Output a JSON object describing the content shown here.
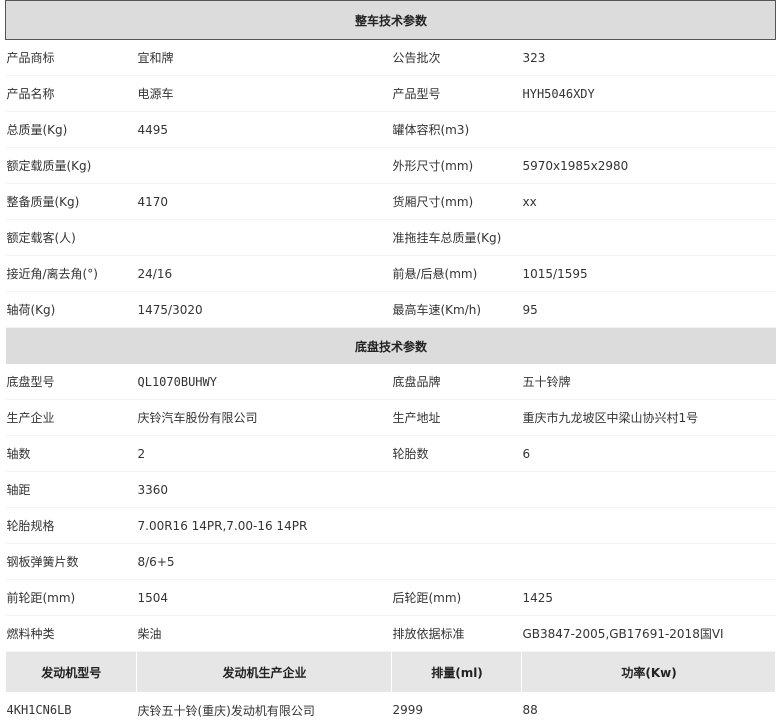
{
  "vehicle": {
    "title": "整车技术参数",
    "rows": [
      [
        "产品商标",
        "宜和牌",
        "公告批次",
        "323"
      ],
      [
        "产品名称",
        "电源车",
        "产品型号",
        "HYH5046XDY"
      ],
      [
        "总质量(Kg)",
        "4495",
        "罐体容积(m3)",
        ""
      ],
      [
        "额定载质量(Kg)",
        "",
        "外形尺寸(mm)",
        "5970x1985x2980"
      ],
      [
        "整备质量(Kg)",
        "4170",
        "货厢尺寸(mm)",
        "xx"
      ],
      [
        "额定载客(人)",
        "",
        "准拖挂车总质量(Kg)",
        ""
      ],
      [
        "接近角/离去角(°)",
        "24/16",
        "前悬/后悬(mm)",
        "1015/1595"
      ],
      [
        "轴荷(Kg)",
        "1475/3020",
        "最高车速(Km/h)",
        "95"
      ]
    ]
  },
  "chassis": {
    "title": "底盘技术参数",
    "rows": [
      [
        "底盘型号",
        "QL1070BUHWY",
        "底盘品牌",
        "五十铃牌"
      ],
      [
        "生产企业",
        "庆铃汽车股份有限公司",
        "生产地址",
        "重庆市九龙坡区中梁山协兴村1号"
      ],
      [
        "轴数",
        "2",
        "轮胎数",
        "6"
      ],
      [
        "轴距",
        "3360",
        "",
        ""
      ],
      [
        "轮胎规格",
        "7.00R16 14PR,7.00-16 14PR",
        "",
        ""
      ],
      [
        "钢板弹簧片数",
        "8/6+5",
        "",
        ""
      ],
      [
        "前轮距(mm)",
        "1504",
        "后轮距(mm)",
        "1425"
      ],
      [
        "燃料种类",
        "柴油",
        "排放依据标准",
        "GB3847-2005,GB17691-2018国VI"
      ]
    ]
  },
  "engine": {
    "headers": [
      "发动机型号",
      "发动机生产企业",
      "排量(ml)",
      "功率(Kw)"
    ],
    "row": [
      "4KH1CN6LB",
      "庆铃五十铃(重庆)发动机有限公司",
      "2999",
      "88"
    ]
  }
}
